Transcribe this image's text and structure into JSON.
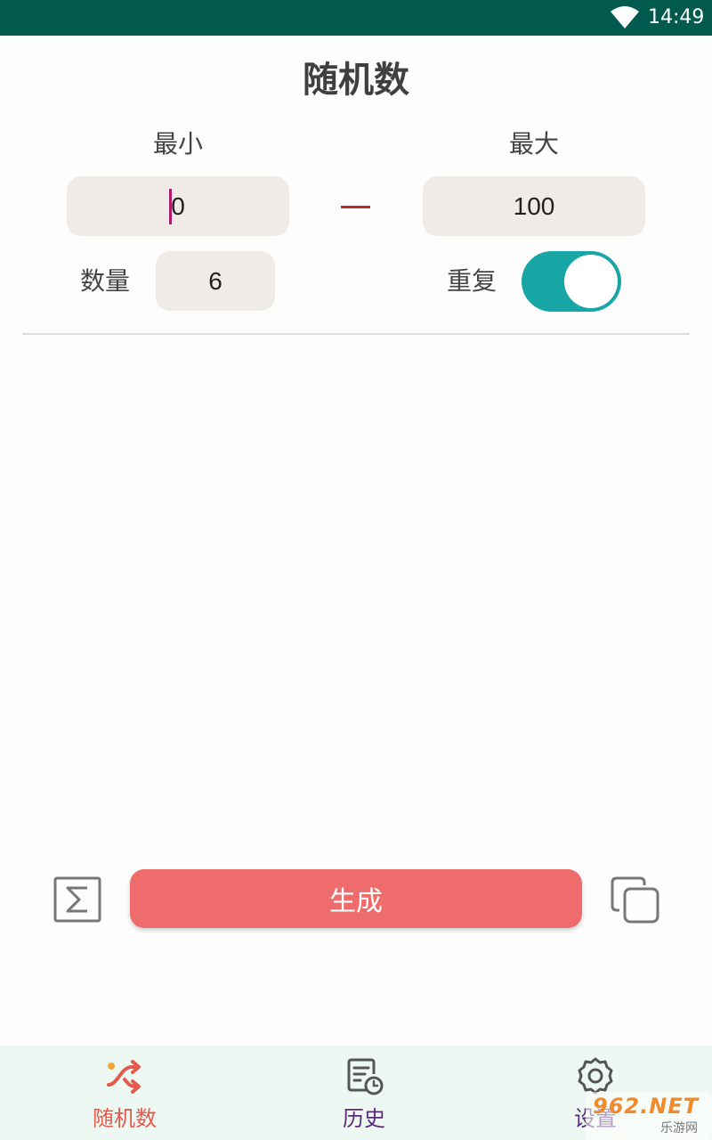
{
  "status_bar": {
    "time": "14:49",
    "wifi_icon": "wifi-icon"
  },
  "header": {
    "title": "随机数"
  },
  "range": {
    "min_label": "最小",
    "max_label": "最大",
    "min_value": "0",
    "max_value": "100"
  },
  "options": {
    "count_label": "数量",
    "count_value": "6",
    "repeat_label": "重复",
    "repeat_enabled": true
  },
  "actions": {
    "sum_icon": "sigma-icon",
    "generate_label": "生成",
    "copy_icon": "copy-icon"
  },
  "bottom_nav": {
    "items": [
      {
        "label": "随机数",
        "icon": "shuffle-icon",
        "active": true
      },
      {
        "label": "历史",
        "icon": "history-icon",
        "active": false
      },
      {
        "label": "设置",
        "icon": "settings-icon",
        "active": false
      }
    ]
  },
  "watermark": {
    "text": "962.NET",
    "subtext": "乐游网"
  },
  "colors": {
    "status_bar": "#025a4e",
    "accent": "#ee6c6c",
    "toggle_on": "#17a5a5",
    "field_bg": "#efebe6",
    "nav_active": "#e45a4c",
    "nav_inactive": "#5a2a7a",
    "nav_bg": "#eef8f2"
  }
}
